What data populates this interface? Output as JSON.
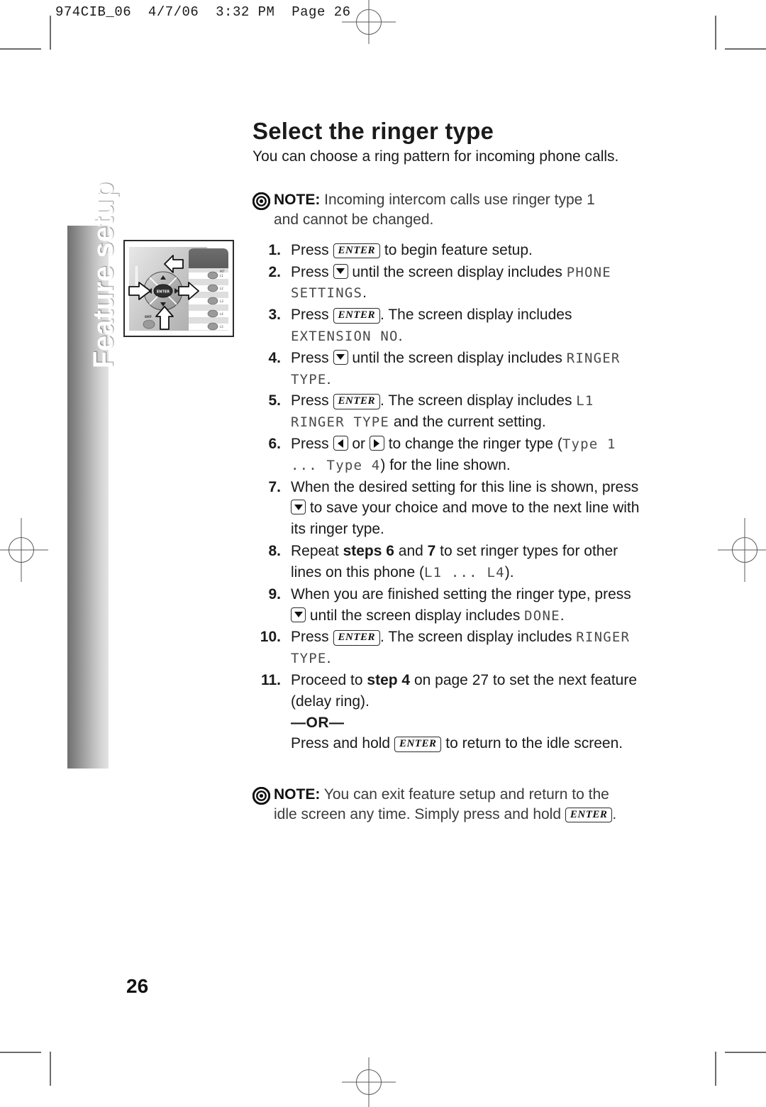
{
  "print_marks": {
    "slug": "974CIB_06  4/7/06  3:32 PM  Page 26"
  },
  "sidetab": {
    "label": "Feature setup"
  },
  "figure": {
    "name": "phone-navigation-keys-diagram",
    "caption": ""
  },
  "page": {
    "title": "Select the ringer type",
    "subtitle": "You can choose a ring pattern for incoming phone calls.",
    "page_number": "26"
  },
  "top_note": {
    "label": "NOTE:",
    "text_line1": "Incoming intercom calls use ringer type 1",
    "text_line2": "and cannot be changed."
  },
  "steps": [
    {
      "number": "1.",
      "parts": [
        {
          "type": "text",
          "value": "Press "
        },
        {
          "type": "key",
          "value": "ENTER"
        },
        {
          "type": "text",
          "value": " to begin feature setup."
        }
      ]
    },
    {
      "number": "2.",
      "parts": [
        {
          "type": "text",
          "value": "Press "
        },
        {
          "type": "key-down",
          "value": "down-arrow"
        },
        {
          "type": "text",
          "value": " until the screen display includes "
        },
        {
          "type": "lcd",
          "value": "PHONE SETTINGS"
        },
        {
          "type": "text",
          "value": "."
        }
      ]
    },
    {
      "number": "3.",
      "parts": [
        {
          "type": "text",
          "value": "Press "
        },
        {
          "type": "key",
          "value": "ENTER"
        },
        {
          "type": "text",
          "value": ". The screen display includes "
        },
        {
          "type": "lcd",
          "value": "EXTENSION NO"
        },
        {
          "type": "text",
          "value": "."
        }
      ]
    },
    {
      "number": "4.",
      "parts": [
        {
          "type": "text",
          "value": "Press "
        },
        {
          "type": "key-down",
          "value": "down-arrow"
        },
        {
          "type": "text",
          "value": " until the screen display includes "
        },
        {
          "type": "lcd",
          "value": "RINGER TYPE"
        },
        {
          "type": "text",
          "value": "."
        }
      ]
    },
    {
      "number": "5.",
      "parts": [
        {
          "type": "text",
          "value": "Press "
        },
        {
          "type": "key",
          "value": "ENTER"
        },
        {
          "type": "text",
          "value": ". The screen display includes "
        },
        {
          "type": "lcd",
          "value": "L1 RINGER TYPE"
        },
        {
          "type": "text",
          "value": " and the current setting."
        }
      ]
    },
    {
      "number": "6.",
      "parts": [
        {
          "type": "text",
          "value": "Press "
        },
        {
          "type": "key-left",
          "value": "left-arrow"
        },
        {
          "type": "text",
          "value": " or "
        },
        {
          "type": "key-right",
          "value": "right-arrow"
        },
        {
          "type": "text",
          "value": " to change the ringer type ("
        },
        {
          "type": "lcd",
          "value": "Type 1 ... Type 4"
        },
        {
          "type": "text",
          "value": ") for the line shown."
        }
      ]
    },
    {
      "number": "7.",
      "parts": [
        {
          "type": "text",
          "value": "When the desired setting for this line is shown, press "
        },
        {
          "type": "key-down",
          "value": "down-arrow"
        },
        {
          "type": "text",
          "value": " to save your choice and move to the next line with its ringer type."
        }
      ]
    },
    {
      "number": "8.",
      "parts": [
        {
          "type": "text",
          "value": "Repeat "
        },
        {
          "type": "bold",
          "value": "steps 6"
        },
        {
          "type": "text",
          "value": " and "
        },
        {
          "type": "bold",
          "value": "7"
        },
        {
          "type": "text",
          "value": " to set ringer types for other lines on this phone ("
        },
        {
          "type": "lcd",
          "value": "L1 ... L4"
        },
        {
          "type": "text",
          "value": ")."
        }
      ]
    },
    {
      "number": "9.",
      "parts": [
        {
          "type": "text",
          "value": "When you are finished setting the ringer type, press "
        },
        {
          "type": "key-down",
          "value": "down-arrow"
        },
        {
          "type": "text",
          "value": " until the screen display includes "
        },
        {
          "type": "lcd",
          "value": "DONE"
        },
        {
          "type": "text",
          "value": "."
        }
      ]
    },
    {
      "number": "10.",
      "parts": [
        {
          "type": "text",
          "value": "Press "
        },
        {
          "type": "key",
          "value": "ENTER"
        },
        {
          "type": "text",
          "value": ". The screen display includes "
        },
        {
          "type": "lcd",
          "value": "RINGER TYPE"
        },
        {
          "type": "text",
          "value": "."
        }
      ]
    },
    {
      "number": "11.",
      "parts": [
        {
          "type": "text",
          "value": "Proceed to "
        },
        {
          "type": "bold",
          "value": "step 4"
        },
        {
          "type": "text",
          "value": " on page 27 to set the next feature (delay ring)."
        },
        {
          "type": "break",
          "value": ""
        },
        {
          "type": "or",
          "value": "—OR—"
        },
        {
          "type": "break",
          "value": ""
        },
        {
          "type": "text",
          "value": "Press and hold "
        },
        {
          "type": "key",
          "value": "ENTER"
        },
        {
          "type": "text",
          "value": " to return to the idle screen."
        }
      ]
    }
  ],
  "bottom_note": {
    "label": "NOTE:",
    "text_line1": "You can exit feature setup and return to the",
    "text_line2a": "idle screen any time.  Simply press and hold ",
    "key": "ENTER",
    "text_line2b": "."
  }
}
